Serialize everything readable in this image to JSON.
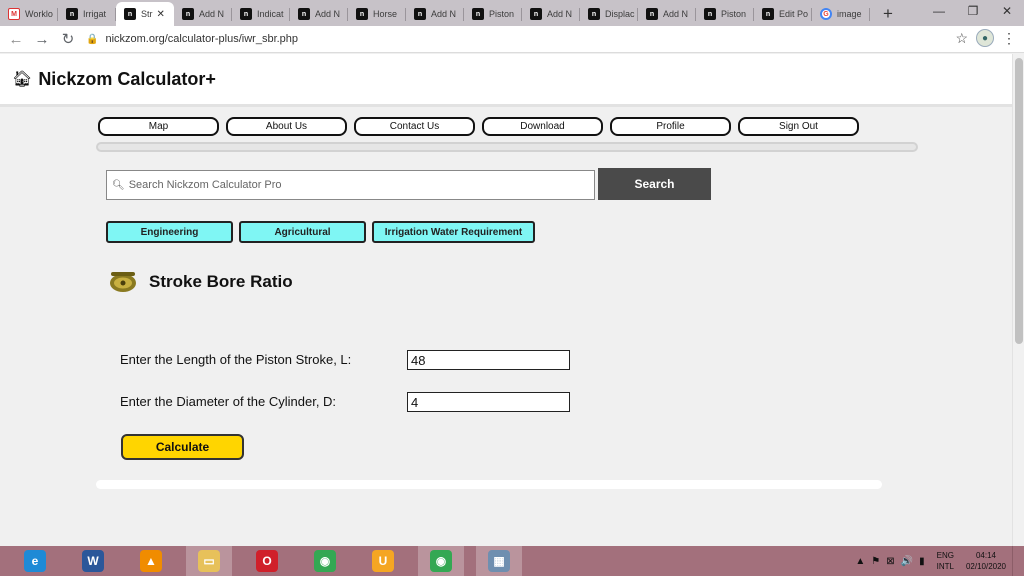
{
  "browser": {
    "tabs": [
      {
        "label": "Worklo",
        "favicon": "gmail-icon"
      },
      {
        "label": "Irrigat",
        "favicon": "nickzom-icon"
      },
      {
        "label": "Str",
        "favicon": "nickzom-icon",
        "active": true
      },
      {
        "label": "Add N",
        "favicon": "nickzom-icon"
      },
      {
        "label": "Indicat",
        "favicon": "nickzom-icon"
      },
      {
        "label": "Add N",
        "favicon": "nickzom-icon"
      },
      {
        "label": "Horse",
        "favicon": "nickzom-icon"
      },
      {
        "label": "Add N",
        "favicon": "nickzom-icon"
      },
      {
        "label": "Piston",
        "favicon": "nickzom-icon"
      },
      {
        "label": "Add N",
        "favicon": "nickzom-icon"
      },
      {
        "label": "Displac",
        "favicon": "nickzom-icon"
      },
      {
        "label": "Add N",
        "favicon": "nickzom-icon"
      },
      {
        "label": "Piston",
        "favicon": "nickzom-icon"
      },
      {
        "label": "Edit Po",
        "favicon": "nickzom-icon"
      },
      {
        "label": "image",
        "favicon": "google-icon"
      }
    ],
    "new_tab": "+",
    "window_controls": [
      "—",
      "❐",
      "✕"
    ],
    "url": "nickzom.org/calculator-plus/iwr_sbr.php"
  },
  "site": {
    "title": "Nickzom Calculator+",
    "nav": [
      "Map",
      "About Us",
      "Contact Us",
      "Download",
      "Profile",
      "Sign Out"
    ],
    "search_placeholder": "Search Nickzom Calculator Pro",
    "search_button": "Search",
    "breadcrumbs": [
      "Engineering",
      "Agricultural",
      "Irrigation Water Requirement"
    ]
  },
  "calculator": {
    "title": "Stroke Bore Ratio",
    "fields": [
      {
        "label": "Enter the Length of the Piston Stroke, L:",
        "value": "48"
      },
      {
        "label": "Enter the Diameter of the Cylinder, D:",
        "value": "4"
      }
    ],
    "calculate_button": "Calculate"
  },
  "taskbar": {
    "apps": [
      {
        "name": "internet-explorer-icon",
        "color": "#1e8ad6",
        "glyph": "e"
      },
      {
        "name": "word-icon",
        "color": "#2b579a",
        "glyph": "W"
      },
      {
        "name": "vlc-icon",
        "color": "#f08c00",
        "glyph": "▲"
      },
      {
        "name": "file-explorer-icon",
        "color": "#e7c15a",
        "glyph": "▭",
        "active": true
      },
      {
        "name": "opera-icon",
        "color": "#d0202a",
        "glyph": "O"
      },
      {
        "name": "chrome-icon",
        "color": "#34a853",
        "glyph": "◉"
      },
      {
        "name": "uc-browser-icon",
        "color": "#f5a623",
        "glyph": "U"
      },
      {
        "name": "chrome-icon",
        "color": "#34a853",
        "glyph": "◉",
        "active": true
      },
      {
        "name": "calculator-icon",
        "color": "#6f8fb0",
        "glyph": "▦",
        "active": true
      }
    ],
    "tray_icons": [
      "▲",
      "⚑",
      "⊠",
      "🔊",
      "▮"
    ],
    "language": [
      "ENG",
      "INTL"
    ],
    "time": "04:14",
    "date": "02/10/2020"
  }
}
